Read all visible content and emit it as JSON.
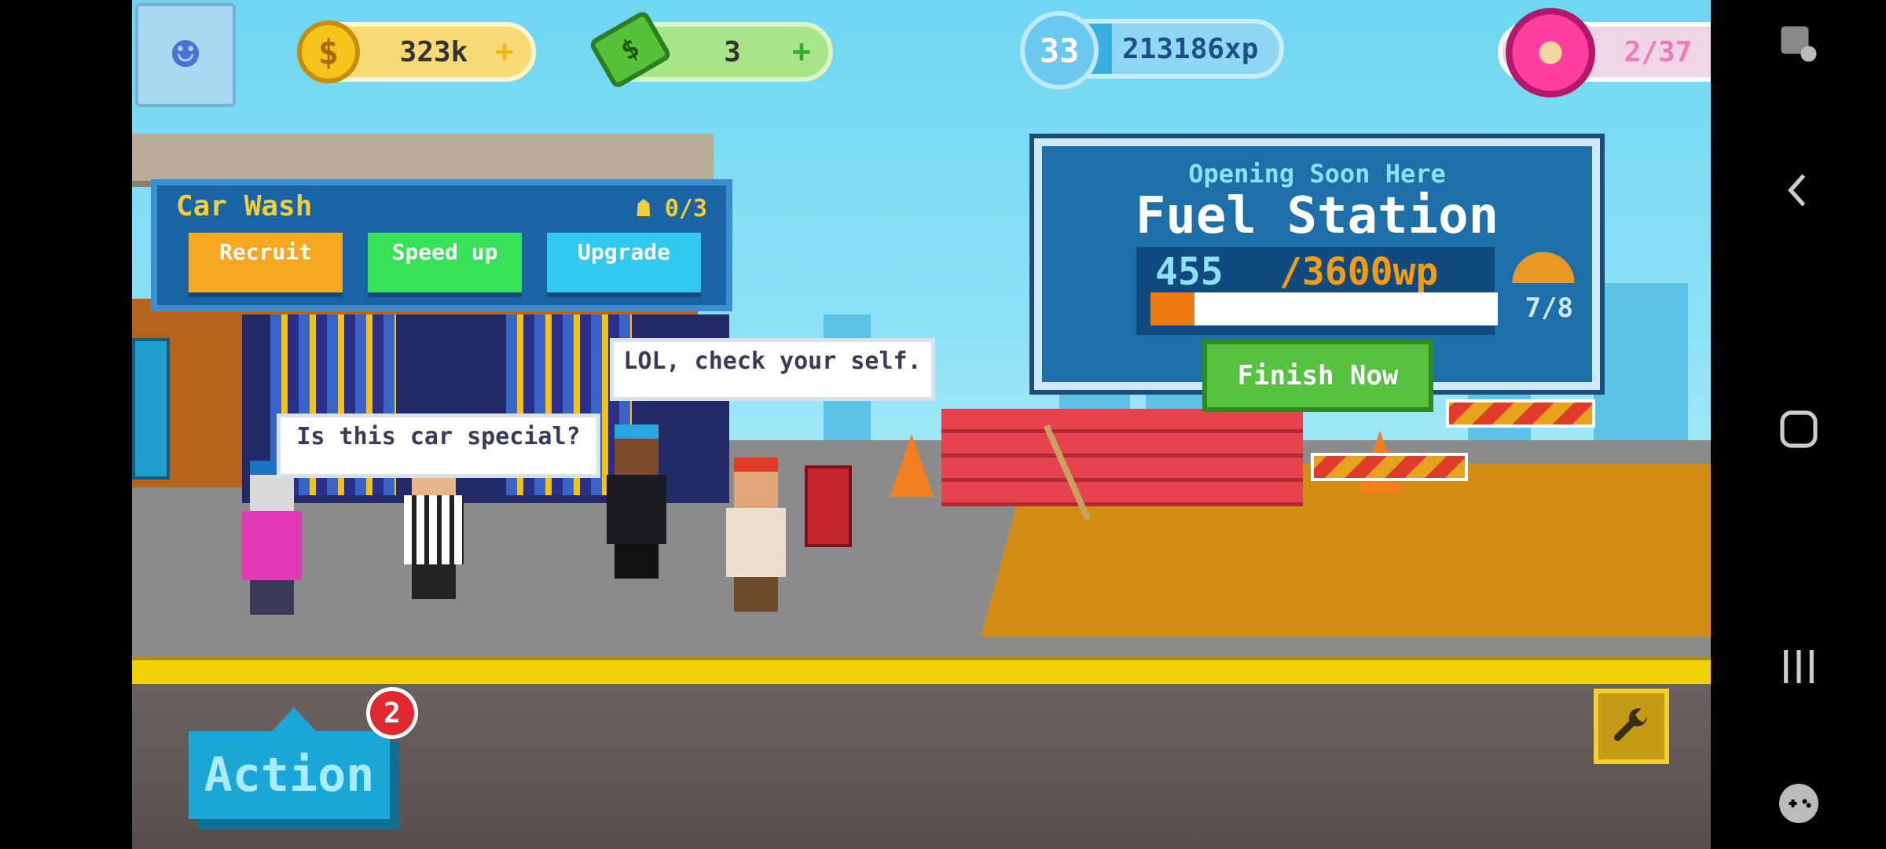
{
  "hud": {
    "coins": "323k",
    "cash": "3",
    "level": "33",
    "xp": "213186xp",
    "xp_progress": 0.33,
    "donuts": "2/37",
    "plus": "+"
  },
  "car_wash": {
    "title": "Car Wash",
    "staff": "0/3",
    "recruit_label": "Recruit",
    "speedup_label": "Speed up",
    "upgrade_label": "Upgrade"
  },
  "fuel_station": {
    "subtitle": "Opening Soon Here",
    "title": "Fuel Station",
    "wp_current": "455",
    "wp_goal": "/3600wp",
    "wp_progress": 0.126,
    "workers": "7/8",
    "finish_label": "Finish Now"
  },
  "speech": {
    "left": "Is this car special?",
    "right": "LOL, check your self."
  },
  "action": {
    "label": "Action",
    "badge": "2"
  },
  "colors": {
    "coin_pill": "#f7d976",
    "cash_pill": "#a8e58a",
    "xp_pill": "#8fd7f2",
    "donut_pill": "#f0d6e4",
    "recruit": "#f6a823",
    "speedup": "#37e259",
    "upgrade": "#31c9ef"
  }
}
